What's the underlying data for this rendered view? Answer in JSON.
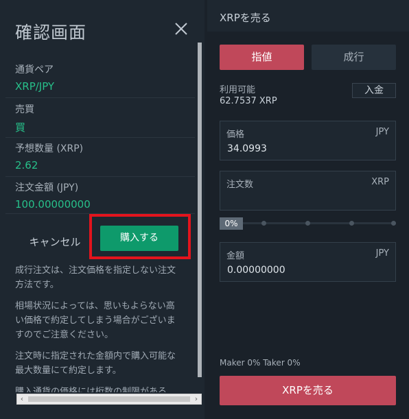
{
  "confirm": {
    "title": "確認画面",
    "fields": [
      {
        "label": "通貨ペア",
        "value": "XRP/JPY"
      },
      {
        "label": "売買",
        "value": "買"
      },
      {
        "label": "予想数量 (XRP)",
        "value": "2.62"
      },
      {
        "label": "注文金額 (JPY)",
        "value": "100.00000000"
      }
    ],
    "cancel_label": "キャンセル",
    "buy_label": "購入する",
    "notes": [
      "成行注文は、注文価格を指定しない注文方法です。",
      "相場状況によっては、思いもよらない高い価格で約定してしまう場合がございますのでご注意ください。",
      "注文時に指定された金額内で購入可能な最大数量にて約定します。",
      "購入通貨の価格には桁数の制限がある"
    ],
    "colors": {
      "accent": "#27c08a",
      "buy": "#0e9a6b",
      "highlight": "#e3141d"
    },
    "icons": {
      "close": "close-icon"
    }
  },
  "sell": {
    "title": "XRPを売る",
    "tabs": {
      "limit": "指値",
      "market": "成行"
    },
    "available_label": "利用可能",
    "available_value": "62.7537 XRP",
    "deposit_label": "入金",
    "price": {
      "label": "価格",
      "unit": "JPY",
      "value": "34.0993"
    },
    "quantity": {
      "label": "注文数",
      "unit": "XRP",
      "value": ""
    },
    "slider_percent_label": "0%",
    "amount": {
      "label": "金額",
      "unit": "JPY",
      "value": "0.00000000"
    },
    "fee_text": "Maker 0% Taker 0%",
    "sell_label": "XRPを売る",
    "colors": {
      "sell": "#c0485a",
      "tab_inactive": "#26313c"
    }
  }
}
